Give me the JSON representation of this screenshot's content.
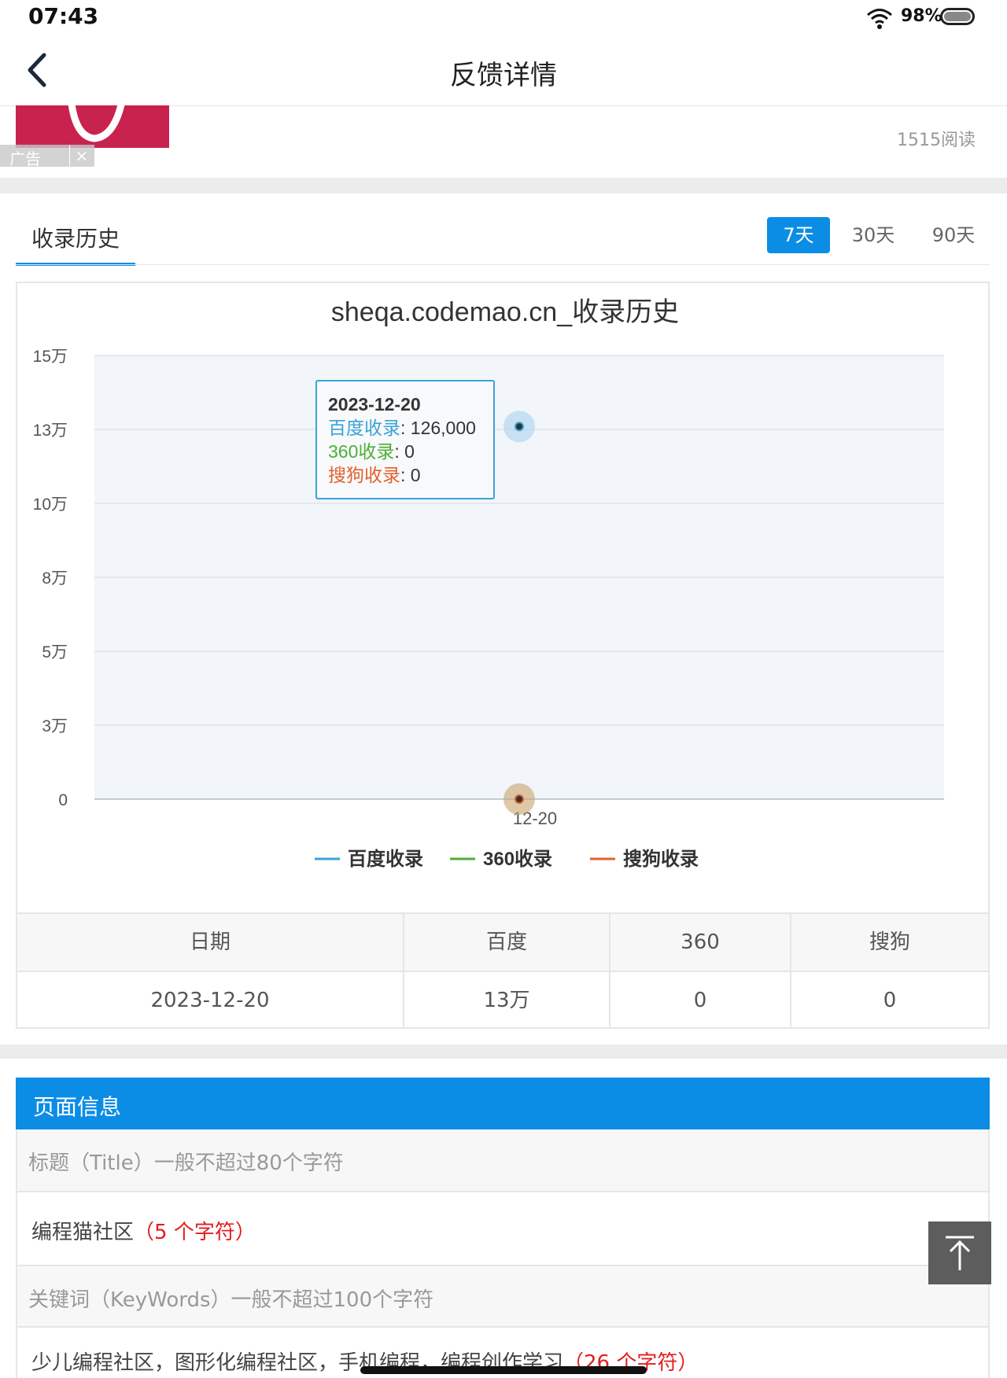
{
  "status_bar": {
    "time": "07:43",
    "battery": "98%"
  },
  "header": {
    "title": "反馈详情"
  },
  "ad": {
    "label": "广告",
    "close": "×",
    "read_count": "1515阅读"
  },
  "tabs": {
    "history": "收录历史",
    "ranges": [
      {
        "label": "7天",
        "active": true
      },
      {
        "label": "30天",
        "active": false
      },
      {
        "label": "90天",
        "active": false
      }
    ]
  },
  "chart_data": {
    "type": "line",
    "title": "sheqa.codemao.cn_收录历史",
    "x": [
      "12-20"
    ],
    "ylim": [
      0,
      150000
    ],
    "yticks": [
      0,
      25000,
      50000,
      75000,
      100000,
      125000,
      150000
    ],
    "ytick_labels": [
      "0",
      "3万",
      "5万",
      "8万",
      "10万",
      "13万",
      "15万"
    ],
    "series": [
      {
        "name": "百度收录",
        "values": [
          126000
        ],
        "color": "#3ba3d6"
      },
      {
        "name": "360收录",
        "values": [
          0
        ],
        "color": "#4caf37"
      },
      {
        "name": "搜狗收录",
        "values": [
          0
        ],
        "color": "#e2622e"
      }
    ],
    "legend": "bottom",
    "grid": true,
    "tooltip": {
      "date": "2023-12-20",
      "rows": [
        {
          "name": "百度收录",
          "value": "126,000",
          "color": "#3ba3d6"
        },
        {
          "name": "360收录",
          "value": "0",
          "color": "#4caf37"
        },
        {
          "name": "搜狗收录",
          "value": "0",
          "color": "#e2622e"
        }
      ]
    }
  },
  "table": {
    "headers": [
      "日期",
      "百度",
      "360",
      "搜狗"
    ],
    "rows": [
      [
        "2023-12-20",
        "13万",
        "0",
        "0"
      ]
    ]
  },
  "page_info": {
    "title": "页面信息",
    "title_hint": "标题（Title）一般不超过80个字符",
    "title_value": "编程猫社区",
    "title_count": "（5 个字符）",
    "keywords_hint": "关键词（KeyWords）一般不超过100个字符",
    "keywords_value": "少儿编程社区，图形化编程社区，手机编程，编程创作学习",
    "keywords_count": "（26 个字符）"
  },
  "colors": {
    "accent": "#0b8de6",
    "plot_bg": "#f2f5f9",
    "ad_bg": "#c8234f"
  },
  "icons": {
    "back": "chevron-left-icon",
    "scroll_top": "arrow-up-icon",
    "wifi": "wifi-icon"
  }
}
